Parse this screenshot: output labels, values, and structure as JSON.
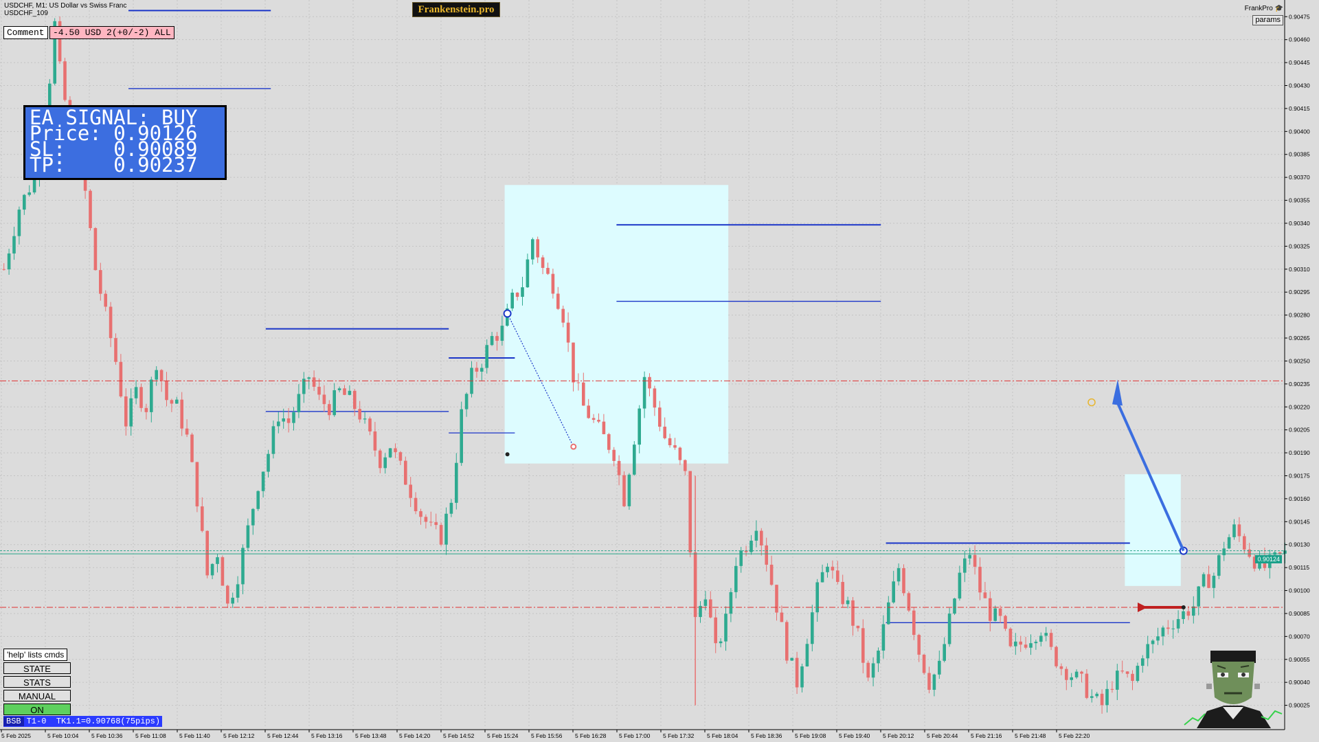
{
  "header": {
    "symbol_line": "USDCHF, M1:  US Dollar vs Swiss Franc",
    "account_line": "USDCHF_109",
    "brand": "Frankenstein.pro",
    "brand_corner": "FrankPro",
    "params_button": "params"
  },
  "comment": {
    "label": "Comment",
    "value": "-4.50 USD 2(+0/-2) ALL"
  },
  "signal": {
    "line1": "EA SIGNAL: BUY",
    "line2": "Price: 0.90126",
    "line3": "SL:    0.90089",
    "line4": "TP:    0.90237"
  },
  "price_tag": "0.90124",
  "panel": {
    "help": "'help' lists cmds",
    "buttons": [
      "STATE",
      "STATS",
      "MANUAL",
      "ON"
    ],
    "status_bsb": "BSB",
    "status_text": "T1-0  TK1.1=0.90768(75pips)"
  },
  "colors": {
    "bull": "#2eaa90",
    "bear": "#e87070",
    "level": "#1a35c8",
    "redline": "#e03030",
    "zone": "#ddfcff"
  },
  "chart_data": {
    "type": "candlestick",
    "symbol": "USDCHF",
    "timeframe": "M1",
    "ylim": [
      0.9001,
      0.90485
    ],
    "y_ticks": [
      "0.90475",
      "0.90460",
      "0.90445",
      "0.90430",
      "0.90415",
      "0.90400",
      "0.90385",
      "0.90370",
      "0.90355",
      "0.90340",
      "0.90325",
      "0.90310",
      "0.90295",
      "0.90280",
      "0.90265",
      "0.90250",
      "0.90235",
      "0.90220",
      "0.90205",
      "0.90190",
      "0.90175",
      "0.90160",
      "0.90145",
      "0.90130",
      "0.90115",
      "0.90100",
      "0.90085",
      "0.90070",
      "0.90055",
      "0.90040",
      "0.90025"
    ],
    "x_ticks": [
      "5 Feb 2025",
      "5 Feb 10:04",
      "5 Feb 10:36",
      "5 Feb 11:08",
      "5 Feb 11:40",
      "5 Feb 12:12",
      "5 Feb 12:44",
      "5 Feb 13:16",
      "5 Feb 13:48",
      "5 Feb 14:20",
      "5 Feb 14:52",
      "5 Feb 15:24",
      "5 Feb 15:56",
      "5 Feb 16:28",
      "5 Feb 17:00",
      "5 Feb 17:32",
      "5 Feb 18:04",
      "5 Feb 18:36",
      "5 Feb 19:08",
      "5 Feb 19:40",
      "5 Feb 20:12",
      "5 Feb 20:44",
      "5 Feb 21:16",
      "5 Feb 21:48",
      "5 Feb 22:20"
    ],
    "close_path": [
      [
        0,
        0.9031
      ],
      [
        3,
        0.9035
      ],
      [
        6,
        0.9037
      ],
      [
        8,
        0.904
      ],
      [
        10,
        0.9047
      ],
      [
        11,
        0.9044
      ],
      [
        13,
        0.904
      ],
      [
        16,
        0.9036
      ],
      [
        18,
        0.9031
      ],
      [
        20,
        0.9028
      ],
      [
        22,
        0.9025
      ],
      [
        24,
        0.9021
      ],
      [
        26,
        0.9023
      ],
      [
        28,
        0.9022
      ],
      [
        30,
        0.9025
      ],
      [
        32,
        0.90225
      ],
      [
        34,
        0.9022
      ],
      [
        36,
        0.902
      ],
      [
        38,
        0.9016
      ],
      [
        40,
        0.9011
      ],
      [
        42,
        0.90125
      ],
      [
        44,
        0.9009
      ],
      [
        46,
        0.9011
      ],
      [
        48,
        0.9014
      ],
      [
        50,
        0.9017
      ],
      [
        52,
        0.9019
      ],
      [
        54,
        0.90215
      ],
      [
        56,
        0.9021
      ],
      [
        58,
        0.90225
      ],
      [
        60,
        0.9024
      ],
      [
        62,
        0.90225
      ],
      [
        64,
        0.9022
      ],
      [
        66,
        0.9023
      ],
      [
        68,
        0.90225
      ],
      [
        70,
        0.90215
      ],
      [
        72,
        0.902
      ],
      [
        74,
        0.90185
      ],
      [
        76,
        0.90195
      ],
      [
        78,
        0.9018
      ],
      [
        80,
        0.90165
      ],
      [
        82,
        0.9015
      ],
      [
        84,
        0.9014
      ],
      [
        86,
        0.90135
      ],
      [
        88,
        0.9016
      ],
      [
        90,
        0.90215
      ],
      [
        92,
        0.9024
      ],
      [
        94,
        0.9025
      ],
      [
        96,
        0.90265
      ],
      [
        98,
        0.9027
      ],
      [
        100,
        0.9029
      ],
      [
        102,
        0.903
      ],
      [
        104,
        0.9033
      ],
      [
        106,
        0.9031
      ],
      [
        108,
        0.903
      ],
      [
        110,
        0.9028
      ],
      [
        112,
        0.9024
      ],
      [
        114,
        0.9022
      ],
      [
        116,
        0.9021
      ],
      [
        118,
        0.902
      ],
      [
        120,
        0.9019
      ],
      [
        122,
        0.9016
      ],
      [
        124,
        0.902
      ],
      [
        126,
        0.9024
      ],
      [
        128,
        0.9022
      ],
      [
        130,
        0.902
      ],
      [
        132,
        0.9019
      ],
      [
        134,
        0.90175
      ],
      [
        136,
        0.9008
      ],
      [
        138,
        0.901
      ],
      [
        140,
        0.9006
      ],
      [
        142,
        0.9008
      ],
      [
        144,
        0.9012
      ],
      [
        146,
        0.9013
      ],
      [
        148,
        0.90145
      ],
      [
        150,
        0.9012
      ],
      [
        152,
        0.9009
      ],
      [
        154,
        0.9006
      ],
      [
        156,
        0.9004
      ],
      [
        158,
        0.9007
      ],
      [
        160,
        0.901
      ],
      [
        162,
        0.9012
      ],
      [
        164,
        0.901
      ],
      [
        166,
        0.9009
      ],
      [
        168,
        0.9007
      ],
      [
        170,
        0.9004
      ],
      [
        172,
        0.9006
      ],
      [
        174,
        0.9009
      ],
      [
        176,
        0.90115
      ],
      [
        178,
        0.9009
      ],
      [
        180,
        0.9006
      ],
      [
        182,
        0.9004
      ],
      [
        184,
        0.9005
      ],
      [
        186,
        0.9008
      ],
      [
        188,
        0.9011
      ],
      [
        190,
        0.90125
      ],
      [
        192,
        0.901
      ],
      [
        194,
        0.90085
      ],
      [
        196,
        0.9008
      ],
      [
        198,
        0.9006
      ],
      [
        200,
        0.90065
      ],
      [
        202,
        0.9007
      ],
      [
        204,
        0.90075
      ],
      [
        206,
        0.9006
      ],
      [
        208,
        0.9005
      ],
      [
        210,
        0.90045
      ],
      [
        212,
        0.9004
      ],
      [
        214,
        0.9003
      ],
      [
        216,
        0.90025
      ],
      [
        218,
        0.9004
      ],
      [
        220,
        0.90045
      ],
      [
        222,
        0.9004
      ],
      [
        224,
        0.9006
      ],
      [
        226,
        0.90065
      ],
      [
        228,
        0.90075
      ],
      [
        230,
        0.9008
      ],
      [
        232,
        0.90085
      ],
      [
        234,
        0.9009
      ],
      [
        236,
        0.90105
      ],
      [
        238,
        0.9011
      ],
      [
        240,
        0.9013
      ],
      [
        242,
        0.9014
      ],
      [
        244,
        0.9013
      ],
      [
        246,
        0.9012
      ],
      [
        248,
        0.90115
      ],
      [
        250,
        0.9012
      ],
      [
        252,
        0.90124
      ]
    ],
    "levels": {
      "bid": 0.90124,
      "ask": 0.90126,
      "sl": 0.90089,
      "tp": 0.90237
    },
    "zones": [
      {
        "from": 99,
        "to": 143,
        "low": 0.90183,
        "high": 0.90365
      },
      {
        "from": 221,
        "to": 232,
        "low": 0.90103,
        "high": 0.90176
      }
    ],
    "segments": [
      {
        "from": 52,
        "to": 88,
        "price": 0.90271
      },
      {
        "from": 52,
        "to": 88,
        "price": 0.90217
      },
      {
        "from": 88,
        "to": 101,
        "price": 0.90252
      },
      {
        "from": 88,
        "to": 101,
        "price": 0.90203
      },
      {
        "from": 121,
        "to": 173,
        "price": 0.90339
      },
      {
        "from": 121,
        "to": 173,
        "price": 0.90289
      },
      {
        "from": 174,
        "to": 222,
        "price": 0.90131
      },
      {
        "from": 174,
        "to": 222,
        "price": 0.90079
      },
      {
        "from": 25,
        "to": 53,
        "price": 0.90479
      },
      {
        "from": 25,
        "to": 53,
        "price": 0.90428
      }
    ]
  }
}
